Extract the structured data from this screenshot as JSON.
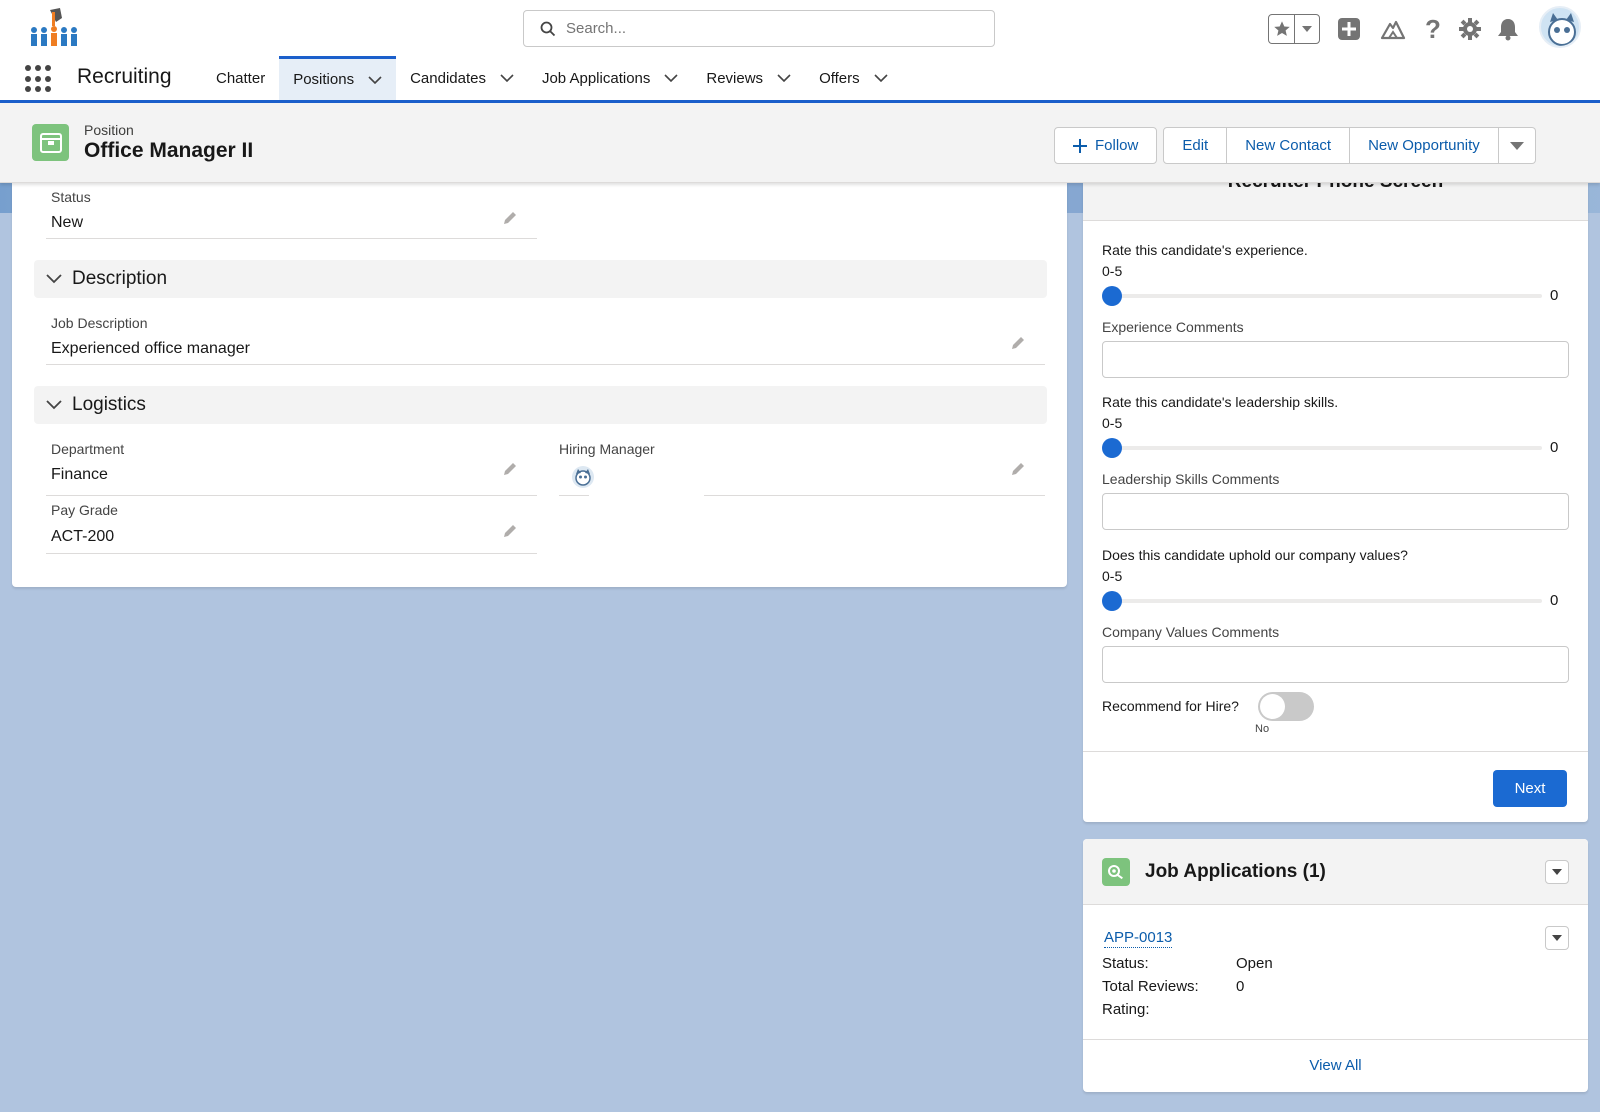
{
  "header": {
    "search_placeholder": "Search...",
    "icons": [
      "favorites-star-icon",
      "favorites-dropdown-icon",
      "global-add-icon",
      "trailhead-icon",
      "help-icon",
      "setup-gear-icon",
      "notifications-bell-icon",
      "user-avatar"
    ]
  },
  "nav": {
    "app_name": "Recruiting",
    "tabs": [
      {
        "label": "Chatter",
        "has_menu": false
      },
      {
        "label": "Positions",
        "has_menu": true,
        "active": true
      },
      {
        "label": "Candidates",
        "has_menu": true
      },
      {
        "label": "Job Applications",
        "has_menu": true
      },
      {
        "label": "Reviews",
        "has_menu": true
      },
      {
        "label": "Offers",
        "has_menu": true
      }
    ]
  },
  "record": {
    "type_label": "Position",
    "title": "Office Manager II",
    "actions": {
      "follow": "Follow",
      "edit": "Edit",
      "new_contact": "New Contact",
      "new_opportunity": "New Opportunity"
    }
  },
  "details": {
    "status_label": "Status",
    "status_value": "New",
    "sections": {
      "description": "Description",
      "logistics": "Logistics"
    },
    "job_description_label": "Job Description",
    "job_description_value": "Experienced office manager",
    "department_label": "Department",
    "department_value": "Finance",
    "hiring_manager_label": "Hiring Manager",
    "pay_grade_label": "Pay Grade",
    "pay_grade_value": "ACT-200"
  },
  "flow": {
    "title": "Recruiter Phone Screen",
    "questions": [
      {
        "question": "Rate this candidate's experience.",
        "range": "0-5",
        "value": "0",
        "comment_label": "Experience Comments"
      },
      {
        "question": "Rate this candidate's leadership skills.",
        "range": "0-5",
        "value": "0",
        "comment_label": "Leadership Skills Comments"
      },
      {
        "question": "Does this candidate uphold our company values?",
        "range": "0-5",
        "value": "0",
        "comment_label": "Company Values Comments"
      }
    ],
    "recommend_label": "Recommend for Hire?",
    "recommend_state": "No",
    "next_label": "Next"
  },
  "related": {
    "title": "Job Applications (1)",
    "record_link": "APP-0013",
    "fields": [
      {
        "key": "Status:",
        "value": "Open"
      },
      {
        "key": "Total Reviews:",
        "value": "0"
      },
      {
        "key": "Rating:",
        "value": ""
      }
    ],
    "view_all": "View All"
  },
  "colors": {
    "brand_blue": "#1b6ad2",
    "link_blue": "#0b5cab",
    "position_icon_green": "#7dc37d",
    "page_background": "#b0c4df"
  }
}
